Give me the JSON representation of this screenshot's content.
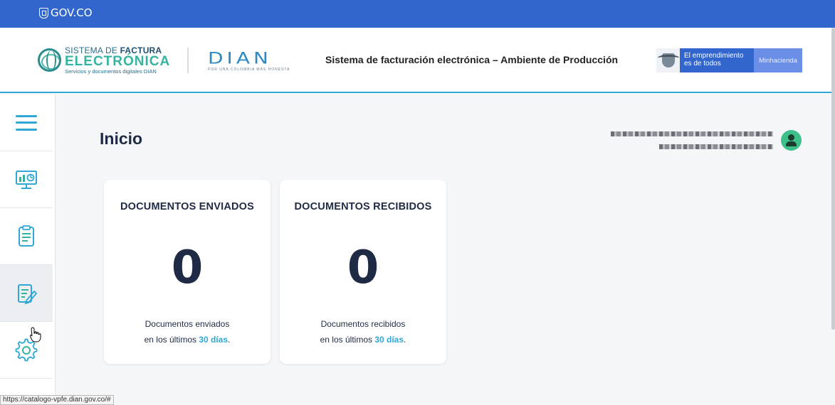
{
  "govbar": {
    "logo_text": "GOV.CO"
  },
  "header": {
    "brand": {
      "line1_prefix": "SISTEMA DE ",
      "line1_bold": "FACTURA",
      "line2": "ELECTRÓNICA",
      "line3": "Servicios y documentos digitales DIAN"
    },
    "dian_logo": "DIAN",
    "dian_tagline": "POR UNA COLOMBIA MÁS HONESTA",
    "title": "Sistema de facturación electrónica – Ambiente de Producción",
    "ministry": {
      "slogan": "El emprendimiento es de todos",
      "name": "Minhacienda"
    }
  },
  "sidebar": {
    "items": [
      {
        "icon": "menu-icon"
      },
      {
        "icon": "dashboard-monitor-icon"
      },
      {
        "icon": "document-list-icon"
      },
      {
        "icon": "document-edit-icon",
        "active": true
      },
      {
        "icon": "gear-icon"
      }
    ]
  },
  "main": {
    "title": "Inicio",
    "cards": [
      {
        "title": "DOCUMENTOS ENVIADOS",
        "count": "0",
        "desc_line1": "Documentos enviados",
        "desc_prefix": "en los últimos ",
        "desc_highlight": "30 días",
        "desc_suffix": "."
      },
      {
        "title": "DOCUMENTOS RECIBIDOS",
        "count": "0",
        "desc_line1": "Documentos recibidos",
        "desc_prefix": "en los últimos ",
        "desc_highlight": "30 días",
        "desc_suffix": "."
      }
    ]
  },
  "status_bar": {
    "url": "https://catalogo-vpfe.dian.gov.co/#"
  },
  "colors": {
    "gov_blue": "#3366cc",
    "accent": "#2fa8d6",
    "brand_green": "#36b3a0",
    "avatar": "#3dbf8a"
  }
}
